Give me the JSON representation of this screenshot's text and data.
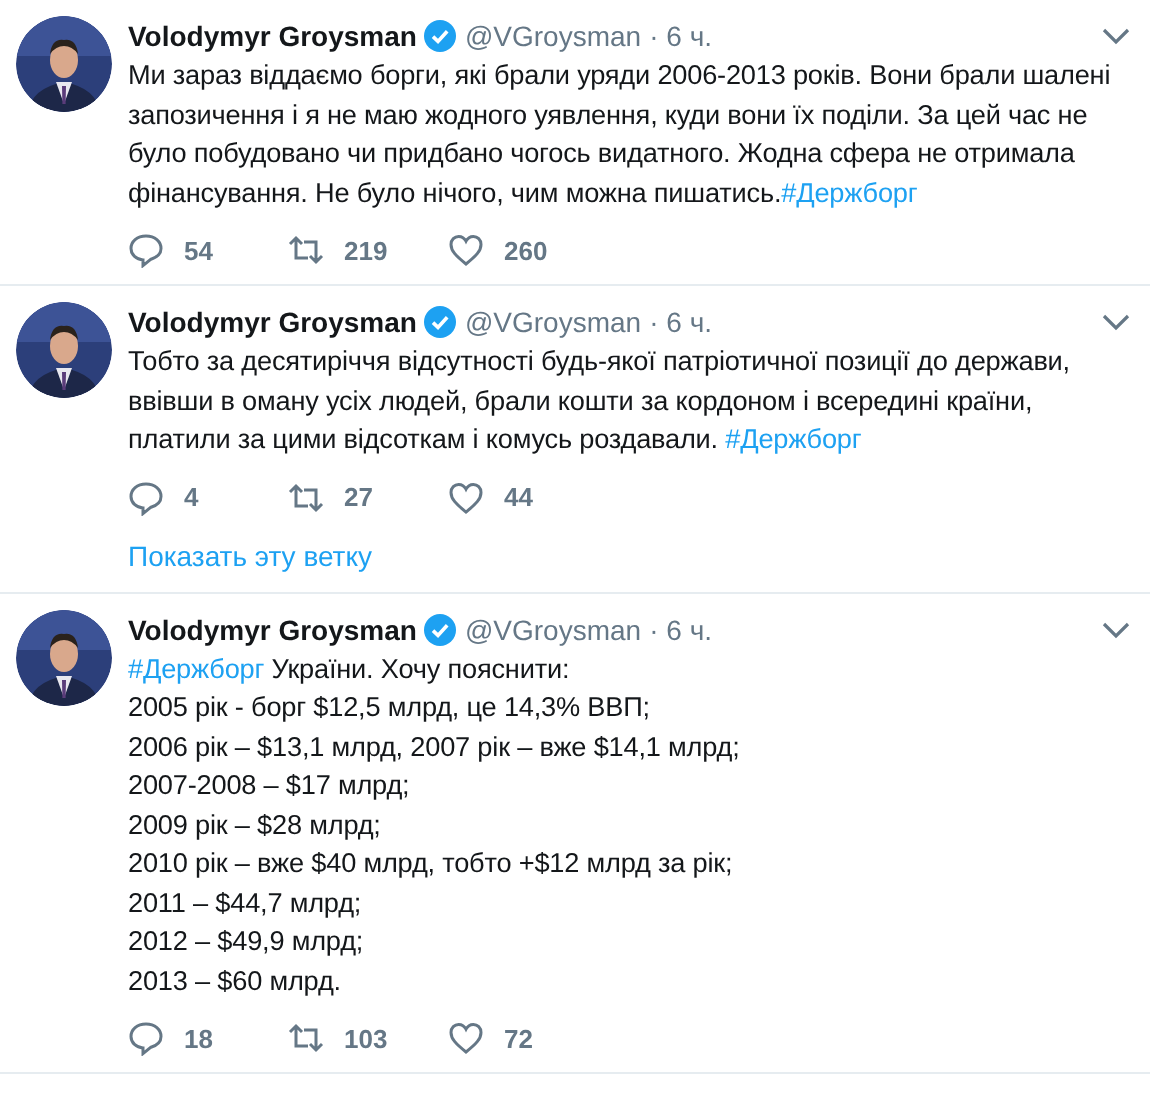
{
  "tweets": [
    {
      "name": "Volodymyr Groysman",
      "verified": true,
      "handle": "@VGroysman",
      "separator": "·",
      "time": "6 ч.",
      "lines": [
        [
          {
            "kind": "plain",
            "text": "Ми зараз віддаємо борги, які брали уряди 2006-2013 років. Вони брали шалені запозичення і я не маю жодного уявлення, куди вони їх поділи. За цей час не було побудовано чи придбано чогось видатного. Жодна сфера не отримала фінансування. Не було нічого, чим можна пишатись."
          },
          {
            "kind": "hashtag",
            "text": "#Держборг"
          }
        ]
      ],
      "replies": "54",
      "retweets": "219",
      "likes": "260"
    },
    {
      "name": "Volodymyr Groysman",
      "verified": true,
      "handle": "@VGroysman",
      "separator": "·",
      "time": "6 ч.",
      "lines": [
        [
          {
            "kind": "plain",
            "text": "Тобто за десятиріччя відсутності будь-якої патріотичної позиції до держави, ввівши в оману усіх людей, брали кошти за кордоном і всередині країни, платили за цими відсоткам і комусь роздавали. "
          },
          {
            "kind": "hashtag",
            "text": "#Держборг"
          }
        ]
      ],
      "replies": "4",
      "retweets": "27",
      "likes": "44",
      "thread_link": "Показать эту ветку"
    },
    {
      "name": "Volodymyr Groysman",
      "verified": true,
      "handle": "@VGroysman",
      "separator": "·",
      "time": "6 ч.",
      "lines": [
        [
          {
            "kind": "hashtag",
            "text": "#Держборг"
          },
          {
            "kind": "plain",
            "text": " України. Хочу пояснити:"
          }
        ],
        [
          {
            "kind": "plain",
            "text": "2005 рік - борг $12,5 млрд, це 14,3% ВВП;"
          }
        ],
        [
          {
            "kind": "plain",
            "text": "2006 рік – $13,1 млрд, 2007 рік – вже $14,1 млрд;"
          }
        ],
        [
          {
            "kind": "plain",
            "text": "2007-2008 – $17 млрд;"
          }
        ],
        [
          {
            "kind": "plain",
            "text": "2009 рік – $28 млрд;"
          }
        ],
        [
          {
            "kind": "plain",
            "text": "2010 рік – вже $40 млрд, тобто +$12 млрд за рік;"
          }
        ],
        [
          {
            "kind": "plain",
            "text": "2011 – $44,7 млрд;"
          }
        ],
        [
          {
            "kind": "plain",
            "text": "2012 – $49,9 млрд;"
          }
        ],
        [
          {
            "kind": "plain",
            "text": "2013 – $60 млрд."
          }
        ]
      ],
      "replies": "18",
      "retweets": "103",
      "likes": "72"
    }
  ]
}
